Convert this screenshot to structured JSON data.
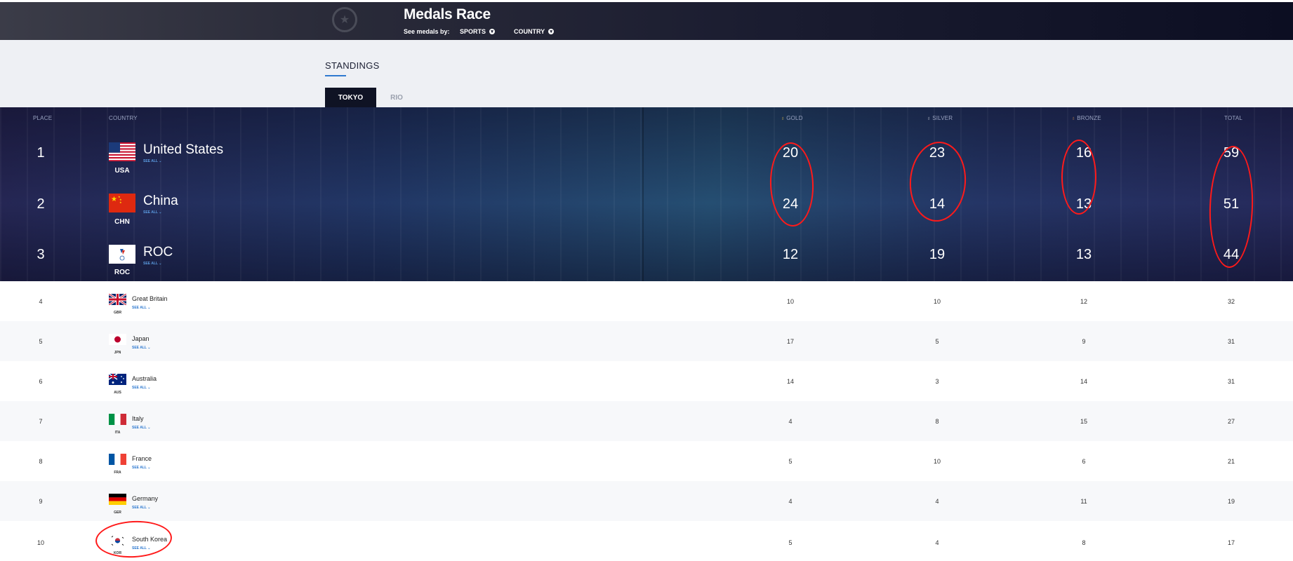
{
  "header": {
    "title": "Medals Race",
    "see_medals_by": "See medals by:",
    "filter_sports": "SPORTS",
    "filter_country": "COUNTRY"
  },
  "standings": {
    "title": "STANDINGS",
    "tabs": [
      "TOKYO",
      "RIO"
    ],
    "active_tab": "TOKYO"
  },
  "columns": {
    "place": "PLACE",
    "country": "COUNTRY",
    "gold": "GOLD",
    "silver": "SILVER",
    "bronze": "BRONZE",
    "total": "TOTAL"
  },
  "see_all": "SEE ALL",
  "colors": {
    "accent": "#2f7ad0",
    "annotation": "#ff1a1a",
    "header_dark": "#0f1324"
  },
  "rows": [
    {
      "place": "1",
      "name": "United States",
      "code": "USA",
      "gold": "20",
      "silver": "23",
      "bronze": "16",
      "total": "59"
    },
    {
      "place": "2",
      "name": "China",
      "code": "CHN",
      "gold": "24",
      "silver": "14",
      "bronze": "13",
      "total": "51"
    },
    {
      "place": "3",
      "name": "ROC",
      "code": "ROC",
      "gold": "12",
      "silver": "19",
      "bronze": "13",
      "total": "44"
    },
    {
      "place": "4",
      "name": "Great Britain",
      "code": "GBR",
      "gold": "10",
      "silver": "10",
      "bronze": "12",
      "total": "32"
    },
    {
      "place": "5",
      "name": "Japan",
      "code": "JPN",
      "gold": "17",
      "silver": "5",
      "bronze": "9",
      "total": "31"
    },
    {
      "place": "6",
      "name": "Australia",
      "code": "AUS",
      "gold": "14",
      "silver": "3",
      "bronze": "14",
      "total": "31"
    },
    {
      "place": "7",
      "name": "Italy",
      "code": "ITA",
      "gold": "4",
      "silver": "8",
      "bronze": "15",
      "total": "27"
    },
    {
      "place": "8",
      "name": "France",
      "code": "FRA",
      "gold": "5",
      "silver": "10",
      "bronze": "6",
      "total": "21"
    },
    {
      "place": "9",
      "name": "Germany",
      "code": "GER",
      "gold": "4",
      "silver": "4",
      "bronze": "11",
      "total": "19"
    },
    {
      "place": "10",
      "name": "South Korea",
      "code": "KOR",
      "gold": "5",
      "silver": "4",
      "bronze": "8",
      "total": "17"
    }
  ]
}
